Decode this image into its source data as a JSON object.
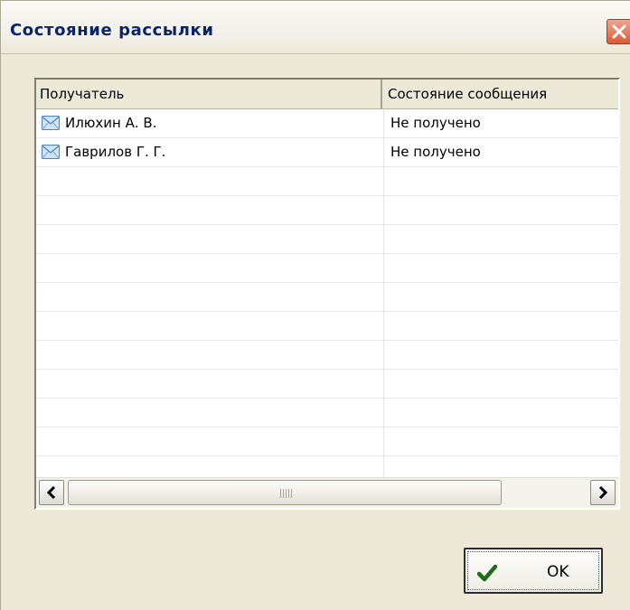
{
  "dialog": {
    "title": "Состояние рассылки"
  },
  "table": {
    "columns": [
      "Получатель",
      "Состояние сообщения"
    ],
    "rows": [
      {
        "recipient": "Илюхин А. В.",
        "status": "Не получено",
        "icon": "mail-icon"
      },
      {
        "recipient": "Гаврилов Г. Г.",
        "status": "Не получено",
        "icon": "mail-icon"
      }
    ]
  },
  "buttons": {
    "ok_label": "OK"
  },
  "icons": {
    "close": "close-icon",
    "check": "check-icon",
    "scroll_left": "arrow-left-icon",
    "scroll_right": "arrow-right-icon"
  },
  "colors": {
    "window_bg": "#ece9d8",
    "title_text": "#0a246a",
    "close_button": "#d95b3a",
    "check_green": "#1f6b1c"
  }
}
